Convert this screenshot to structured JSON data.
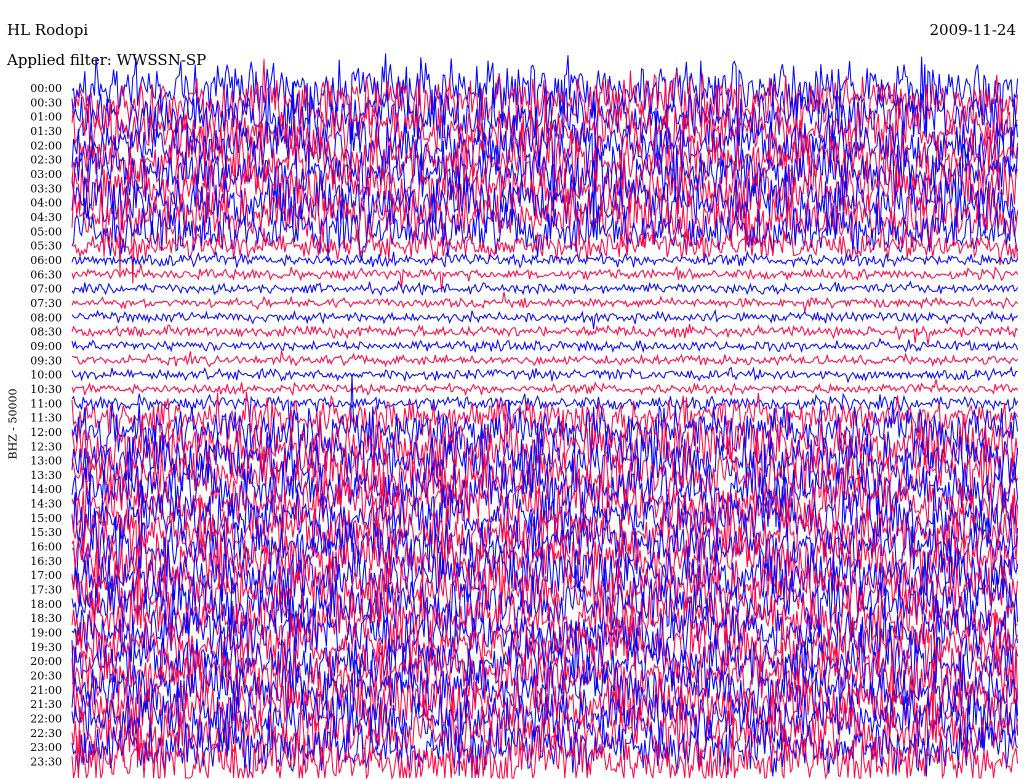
{
  "header": {
    "station": "HL Rodopi",
    "date": "2009-11-24",
    "filter_text": "Applied filter: WWSSN-SP"
  },
  "chart_data": {
    "type": "line",
    "title": "HL Rodopi",
    "subtitle": "Applied filter: WWSSN-SP",
    "date": "2009-11-24",
    "ylabel": "BHZ - 50000",
    "xlabel": "",
    "row_interval_minutes": 30,
    "rows": [
      "00:00",
      "00:30",
      "01:00",
      "01:30",
      "02:00",
      "02:30",
      "03:00",
      "03:30",
      "04:00",
      "04:30",
      "05:00",
      "05:30",
      "06:00",
      "06:30",
      "07:00",
      "07:30",
      "08:00",
      "08:30",
      "09:00",
      "09:30",
      "10:00",
      "10:30",
      "11:00",
      "11:30",
      "12:00",
      "12:30",
      "13:00",
      "13:30",
      "14:00",
      "14:30",
      "15:00",
      "15:30",
      "16:00",
      "16:30",
      "17:00",
      "17:30",
      "18:00",
      "18:30",
      "19:00",
      "19:30",
      "20:00",
      "20:30",
      "21:00",
      "21:30",
      "22:00",
      "22:30",
      "23:00",
      "23:30"
    ],
    "trace_colors": [
      "#0000ff",
      "#ff0040"
    ],
    "relative_noise_level": [
      3.0,
      3.0,
      3.0,
      3.0,
      3.0,
      3.0,
      3.0,
      3.0,
      3.0,
      3.0,
      2.6,
      1.6,
      0.7,
      0.6,
      0.55,
      0.5,
      0.55,
      0.6,
      0.55,
      0.55,
      0.6,
      0.55,
      0.8,
      2.0,
      2.6,
      3.0,
      3.0,
      3.0,
      3.0,
      3.0,
      3.0,
      3.0,
      3.0,
      3.0,
      3.0,
      3.0,
      3.0,
      3.0,
      3.0,
      3.0,
      3.0,
      3.0,
      3.0,
      3.0,
      3.0,
      3.0,
      3.0,
      3.0
    ],
    "grid": false
  }
}
